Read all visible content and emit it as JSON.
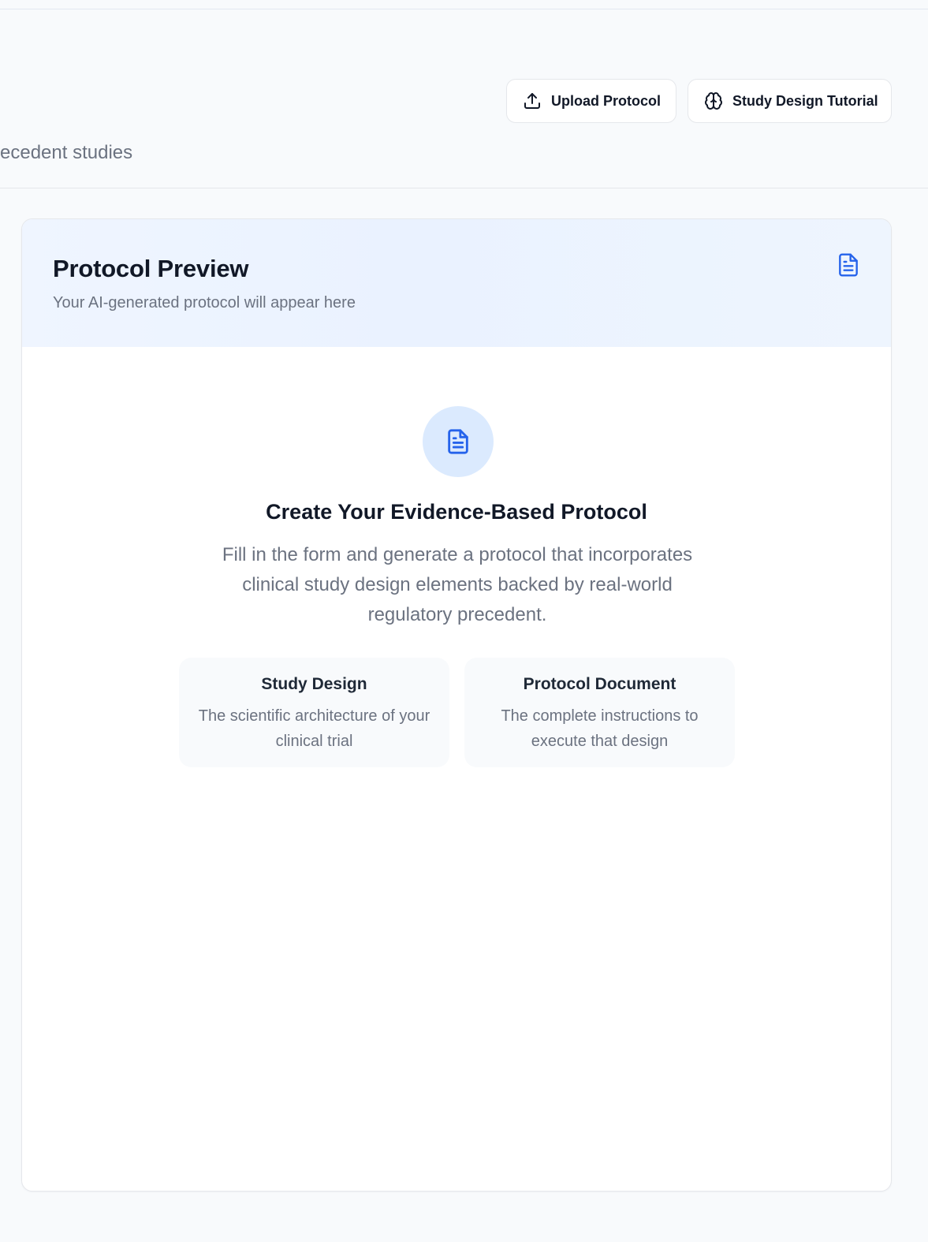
{
  "header": {
    "subtitle_partial": "ecedent studies",
    "upload_button": {
      "label": "Upload Protocol",
      "icon": "upload-icon"
    },
    "tutorial_button": {
      "label": "Study Design Tutorial",
      "icon": "brain-icon"
    }
  },
  "preview": {
    "title": "Protocol Preview",
    "subtitle": "Your AI-generated protocol will appear here",
    "header_icon": "file-text-icon",
    "empty_state": {
      "icon": "file-text-icon",
      "title": "Create Your Evidence-Based Protocol",
      "description": "Fill in the form and generate a protocol that incorporates clinical study design elements backed by real-world regulatory precedent.",
      "features": [
        {
          "title": "Study Design",
          "description": "The scientific architecture of your clinical trial"
        },
        {
          "title": "Protocol Document",
          "description": "The complete instructions to execute that design"
        }
      ]
    }
  },
  "colors": {
    "accent": "#2563eb",
    "accent_soft": "#dbeafe",
    "header_bg": "#eaf2ff",
    "page_bg": "#f8fafc",
    "muted_text": "#6b7280"
  }
}
